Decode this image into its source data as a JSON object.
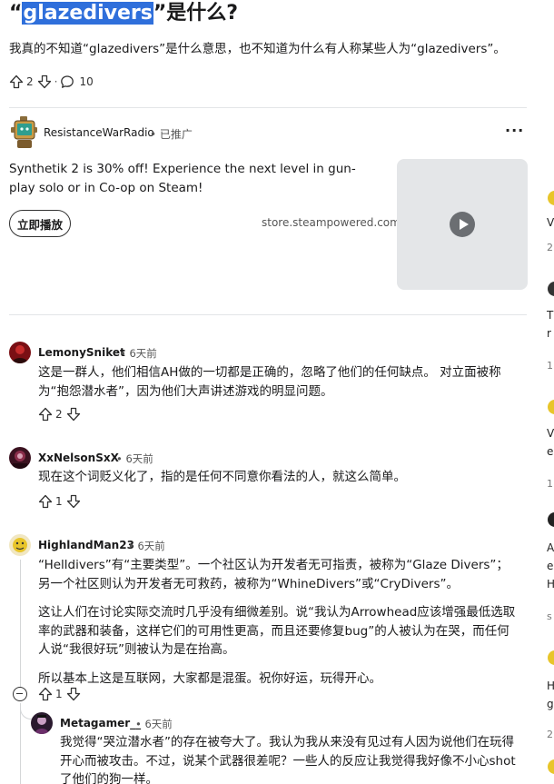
{
  "post": {
    "title_open": "“",
    "title_highlight": "glazedivers",
    "title_rest": "”是什么?",
    "body": "我真的不知道“glazedivers”是什么意思，也不知道为什么有人称某些人为“glazedivers”。",
    "upvotes": "2",
    "comments": "10"
  },
  "ad": {
    "advertiser": "ResistanceWarRadio",
    "promoted_label": "• 已推广",
    "more_label": "···",
    "text": "Synthetik 2 is 30% off! Experience the next level in gun-play solo or in Co-op on Steam!",
    "cta_label": "立即播放",
    "domain": "store.steampowered.com"
  },
  "comments": [
    {
      "user": "LemonySniket",
      "time": "• 6天前",
      "paragraphs": [
        "这是一群人，他们相信AH做的一切都是正确的，忽略了他们的任何缺点。 对立面被称为“抱怨潜水者”，因为他们大声讲述游戏的明显问题。"
      ],
      "votes": "2"
    },
    {
      "user": "XxNelsonSxX",
      "time": "• 6天前",
      "paragraphs": [
        "现在这个词贬义化了，指的是任何不同意你看法的人，就这么简单。"
      ],
      "votes": "1"
    },
    {
      "user": "HighlandMan23",
      "time": "• 6天前",
      "paragraphs": [
        "“Helldivers”有“主要类型”。一个社区认为开发者无可指责，被称为“Glaze Divers”；另一个社区则认为开发者无可救药，被称为“WhineDivers”或“CryDivers”。",
        "这让人们在讨论实际交流时几乎没有细微差别。说“我认为Arrowhead应该增强最低选取率的武器和装备，这样它们的可用性更高，而且还要修复bug”的人被认为在哭，而任何人说“我很好玩”则被认为是在抬高。",
        "所以基本上这是互联网，大家都是混蛋。祝你好运，玩得开心。"
      ],
      "votes": "1"
    },
    {
      "user": "Metagamer__",
      "time": "• 6天前",
      "paragraphs": [
        "我觉得“哭泣潜水者”的存在被夸大了。我认为我从来没有见过有人因为说他们在玩得开心而被攻击。不过，说某个武器很差呢？一些人的反应让我觉得我好像不小心shot了他们的狗一样。"
      ],
      "votes": ""
    }
  ],
  "right_strip": {
    "items": [
      "V",
      "2",
      "T",
      "r",
      "1",
      "V",
      "e",
      "1",
      "A",
      "e",
      "H",
      "s",
      "H",
      "g",
      "2"
    ]
  },
  "colors": {
    "highlight": "#2f6fdb",
    "text": "#1a1a1b",
    "meta": "#555555",
    "divider": "#e3e5e8",
    "thumb_bg": "#e4e6e8"
  }
}
